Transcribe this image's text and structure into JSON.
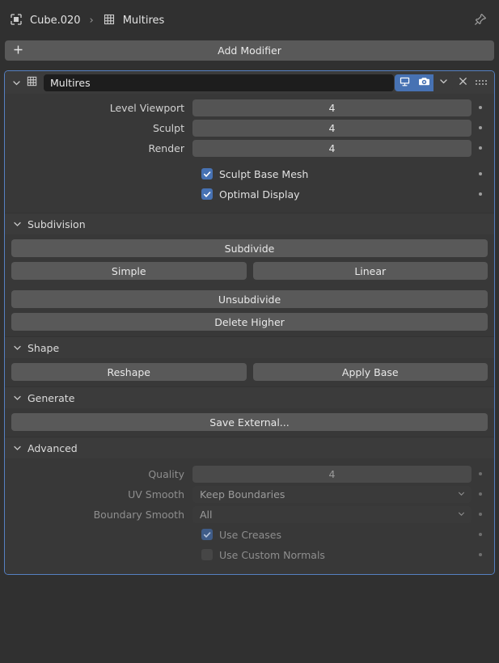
{
  "breadcrumb": {
    "object_icon": "object-icon",
    "object_name": "Cube.020",
    "separator": "›",
    "modifier_icon": "multires-icon",
    "modifier_name": "Multires",
    "pin_icon": "pin-icon"
  },
  "toolbar": {
    "add_modifier_label": "Add Modifier",
    "add_icon": "plus-icon"
  },
  "modifier": {
    "expand_icon": "chevron-down-icon",
    "type_icon": "multires-icon",
    "name": "Multires",
    "display_toggle_icon": "monitor-icon",
    "display_toggle_on": true,
    "render_toggle_icon": "camera-icon",
    "render_toggle_on": true,
    "extras_icon": "chevron-down-icon",
    "close_icon": "close-icon",
    "grip_icon": "drag-grip-icon",
    "accent_color": "#4772b3",
    "border_color": "#5680c2"
  },
  "levels": [
    {
      "label": "Level Viewport",
      "value": "4"
    },
    {
      "label": "Sculpt",
      "value": "4"
    },
    {
      "label": "Render",
      "value": "4"
    }
  ],
  "checkboxes": [
    {
      "label": "Sculpt Base Mesh",
      "checked": true
    },
    {
      "label": "Optimal Display",
      "checked": true
    }
  ],
  "subdivision": {
    "title": "Subdivision",
    "subdivide_label": "Subdivide",
    "simple_label": "Simple",
    "linear_label": "Linear",
    "unsubdivide_label": "Unsubdivide",
    "delete_higher_label": "Delete Higher"
  },
  "shape": {
    "title": "Shape",
    "reshape_label": "Reshape",
    "apply_base_label": "Apply Base"
  },
  "generate": {
    "title": "Generate",
    "save_external_label": "Save External..."
  },
  "advanced": {
    "title": "Advanced",
    "quality_label": "Quality",
    "quality_value": "4",
    "uv_smooth_label": "UV Smooth",
    "uv_smooth_value": "Keep Boundaries",
    "boundary_smooth_label": "Boundary Smooth",
    "boundary_smooth_value": "All",
    "use_creases_label": "Use Creases",
    "use_creases_checked": true,
    "use_custom_normals_label": "Use Custom Normals",
    "use_custom_normals_checked": false
  }
}
